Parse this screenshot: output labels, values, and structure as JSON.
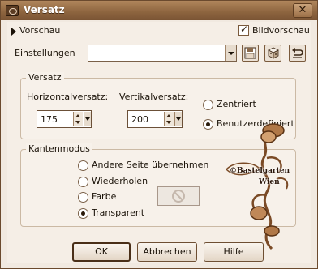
{
  "window": {
    "title": "Versatz",
    "close_glyph": "✕"
  },
  "header": {
    "preview_label": "Vorschau",
    "image_preview_label": "Bildvorschau",
    "image_preview_checked": true,
    "settings_label": "Einstellungen",
    "settings_value": "",
    "tool_icons": [
      "save-icon",
      "random-dice-icon",
      "reset-icon"
    ]
  },
  "offset_group": {
    "title": "Versatz",
    "horizontal_label": "Horizontalversatz:",
    "horizontal_value": "175",
    "vertical_label": "Vertikalversatz:",
    "vertical_value": "200",
    "options": [
      {
        "label": "Zentriert",
        "selected": false
      },
      {
        "label": "Benutzerdefiniert",
        "selected": true
      }
    ]
  },
  "edge_group": {
    "title": "Kantenmodus",
    "options": [
      {
        "label": "Andere Seite übernehmen",
        "selected": false
      },
      {
        "label": "Wiederholen",
        "selected": false
      },
      {
        "label": "Farbe",
        "selected": false
      },
      {
        "label": "Transparent",
        "selected": true
      }
    ]
  },
  "buttons": {
    "ok": "OK",
    "cancel": "Abbrechen",
    "help": "Hilfe"
  },
  "watermark": {
    "line1": "©Bastelgarten",
    "line2": "Wien"
  },
  "colors": {
    "titlebar": "#8f6640",
    "window": "#f1e9e0",
    "border": "#6b4a2e"
  }
}
